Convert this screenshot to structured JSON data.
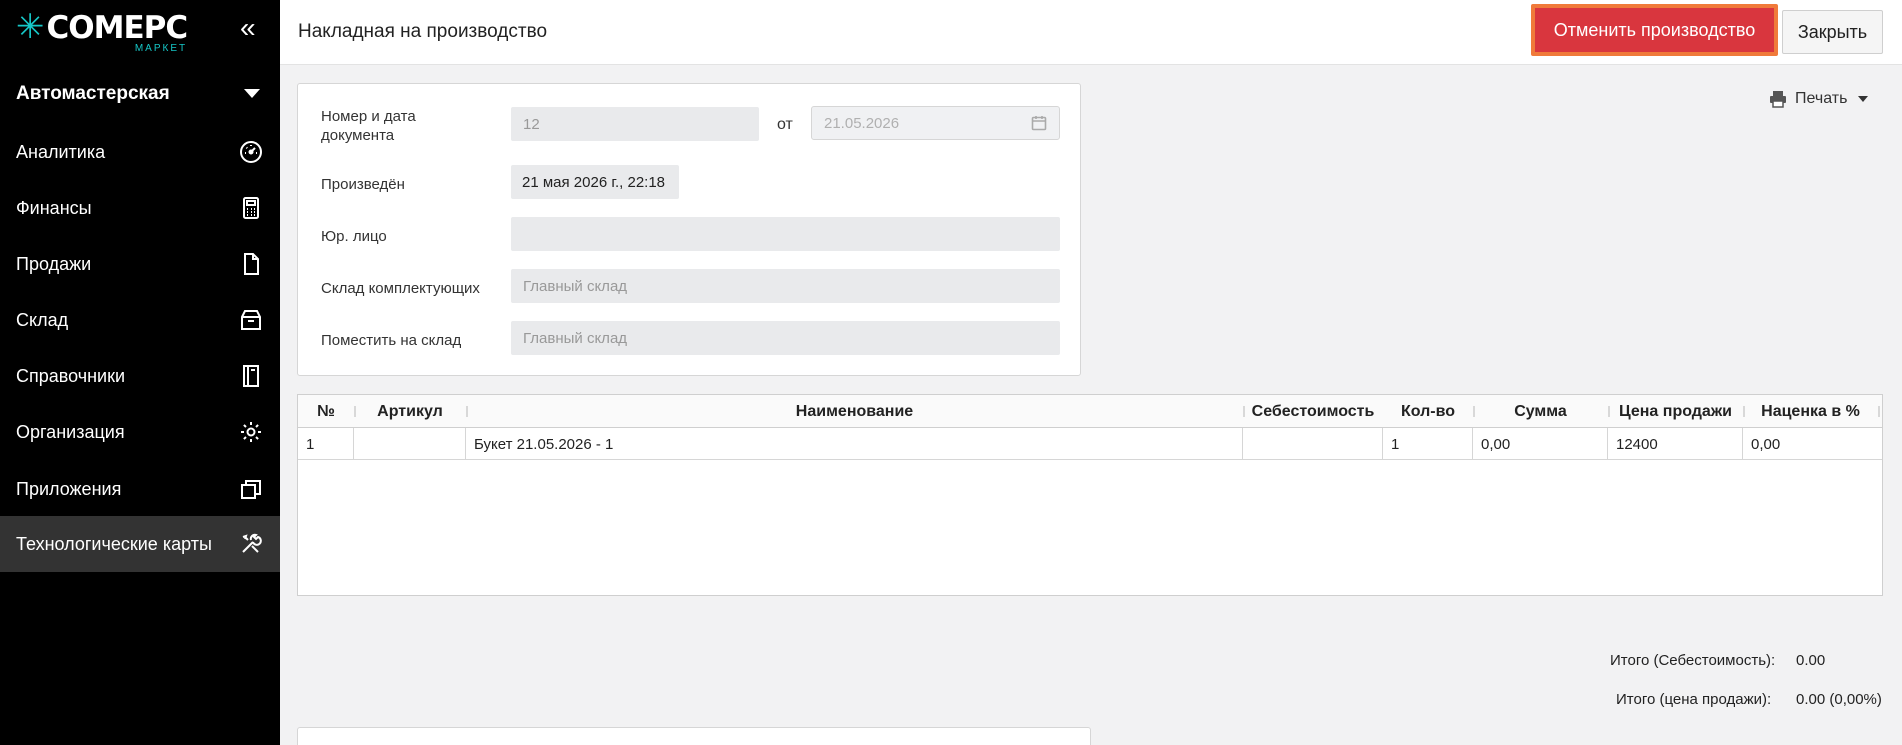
{
  "brand": {
    "logo_main": "COMEPC",
    "logo_sub": "МАРКЕТ",
    "accent": "#16c7c7"
  },
  "sidebar": {
    "company": "Автомастерская",
    "items": [
      {
        "label": "Аналитика",
        "icon": "dashboard-gauge-icon"
      },
      {
        "label": "Финансы",
        "icon": "calculator-icon"
      },
      {
        "label": "Продажи",
        "icon": "document-icon"
      },
      {
        "label": "Склад",
        "icon": "box-icon"
      },
      {
        "label": "Справочники",
        "icon": "book-icon"
      },
      {
        "label": "Организация",
        "icon": "gear-icon"
      },
      {
        "label": "Приложения",
        "icon": "windows-icon"
      },
      {
        "label": "Технологические карты",
        "icon": "tools-icon",
        "active": true
      }
    ]
  },
  "header": {
    "title": "Накладная на производство",
    "cancel_label": "Отменить производство",
    "close_label": "Закрыть"
  },
  "form": {
    "number_label": "Номер и дата документа",
    "number_value": "12",
    "from_label": "от",
    "date_value": "21.05.2026",
    "produced_label": "Произведён",
    "produced_value": "21 мая 2026 г., 22:18",
    "entity_label": "Юр. лицо",
    "entity_value": "",
    "components_label": "Склад комплектующих",
    "components_value": "Главный склад",
    "target_label": "Поместить на склад",
    "target_value": "Главный склад"
  },
  "print": {
    "label": "Печать"
  },
  "table": {
    "headers": [
      "№",
      "Артикул",
      "Наименование",
      "Себестоимость",
      "Кол-во",
      "Сумма",
      "Цена продажи",
      "Наценка в %"
    ],
    "rows": [
      [
        "1",
        "",
        "Букет 21.05.2026 - 1",
        "",
        "1",
        "0,00",
        "12400",
        "0,00"
      ]
    ]
  },
  "totals": {
    "cost_label": "Итого (Себестоимость):",
    "cost_value": "0.00",
    "sale_label": "Итого (цена продажи):",
    "sale_value": "0.00 (0,00%)"
  }
}
